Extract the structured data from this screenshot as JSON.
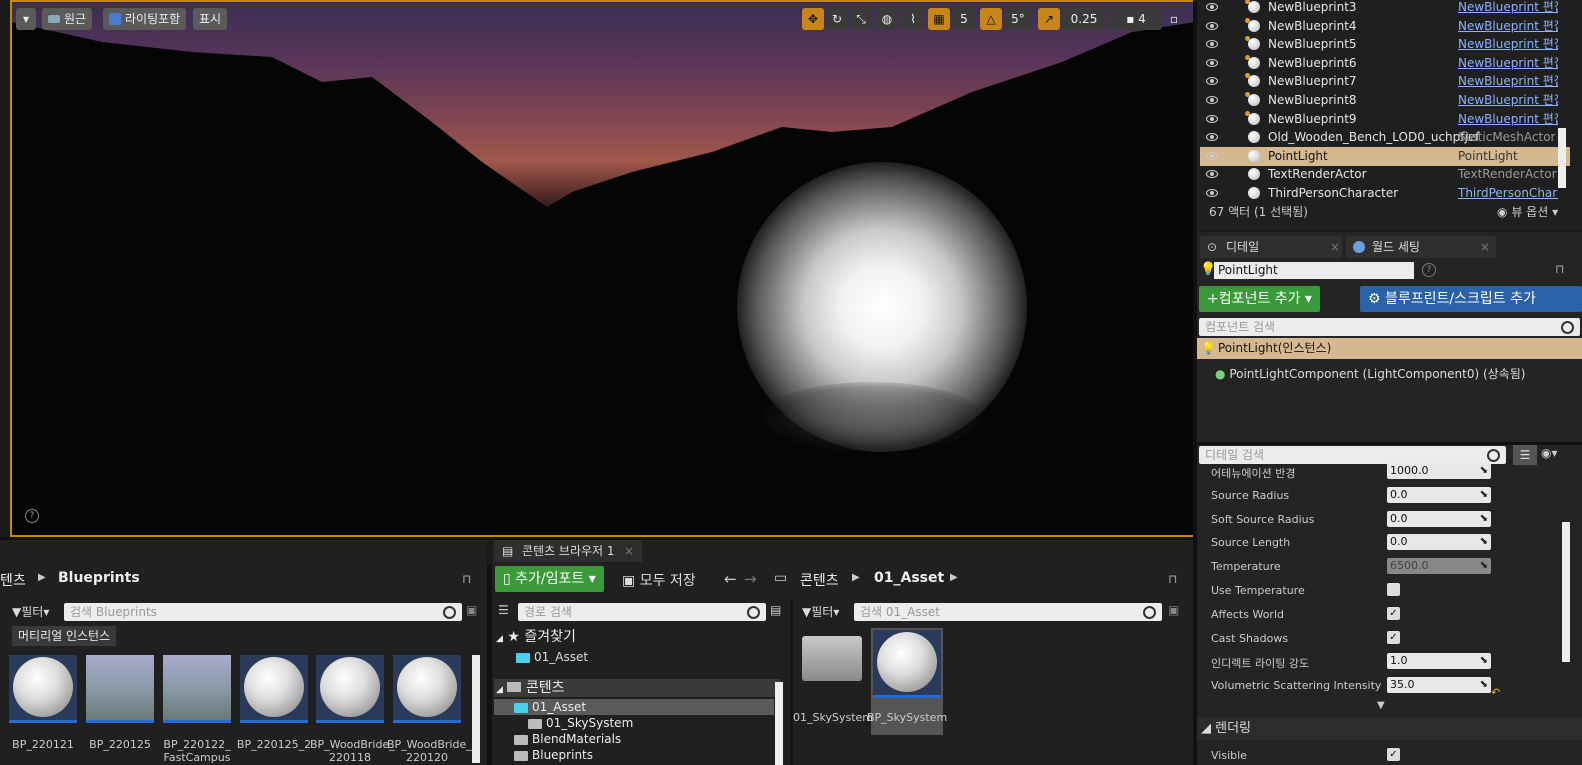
{
  "viewport": {
    "mode_btn": "원근",
    "lighting_btn": "라이팅포함",
    "show_btn": "표시",
    "grid_snap": "5",
    "rot_snap": "5°",
    "scale_snap": "0.25",
    "camera_speed": "4"
  },
  "outliner": {
    "rows": [
      {
        "name": "NewBlueprint3",
        "type": "NewBlueprint 편집"
      },
      {
        "name": "NewBlueprint4",
        "type": "NewBlueprint 편집"
      },
      {
        "name": "NewBlueprint5",
        "type": "NewBlueprint 편집"
      },
      {
        "name": "NewBlueprint6",
        "type": "NewBlueprint 편집"
      },
      {
        "name": "NewBlueprint7",
        "type": "NewBlueprint 편집"
      },
      {
        "name": "NewBlueprint8",
        "type": "NewBlueprint 편집"
      },
      {
        "name": "NewBlueprint9",
        "type": "NewBlueprint 편집"
      },
      {
        "name": "Old_Wooden_Bench_LOD0_uchpfjef",
        "type": "StaticMeshActor"
      },
      {
        "name": "PointLight",
        "type": "PointLight"
      },
      {
        "name": "TextRenderActor",
        "type": "TextRenderActor"
      },
      {
        "name": "ThirdPersonCharacter",
        "type": "ThirdPersonCharacter"
      }
    ],
    "count": "67 액터 (1 선택됨)",
    "view_options": "뷰 옵션"
  },
  "details": {
    "tab_details": "디테일",
    "tab_world": "월드 세팅",
    "actor_name": "PointLight",
    "add_component": "컴포넌트 추가",
    "add_blueprint": "블루프린트/스크립트 추가",
    "component_search": "컴포넌트 검색",
    "instance_label": "PointLight(인스턴스)",
    "component_label": "PointLightComponent (LightComponent0) (상속됨)",
    "detail_search": "디테일 검색",
    "props": [
      {
        "label": "어테뉴에이션 반경",
        "value": "1000.0"
      },
      {
        "label": "Source Radius",
        "value": "0.0"
      },
      {
        "label": "Soft Source Radius",
        "value": "0.0"
      },
      {
        "label": "Source Length",
        "value": "0.0"
      },
      {
        "label": "Temperature",
        "value": "6500.0"
      },
      {
        "label": "Use Temperature",
        "value": ""
      },
      {
        "label": "Affects World",
        "value": "✓"
      },
      {
        "label": "Cast Shadows",
        "value": "✓"
      },
      {
        "label": "인디렉트 라이팅 강도",
        "value": "1.0"
      },
      {
        "label": "Volumetric Scattering Intensity",
        "value": "35.0"
      }
    ],
    "section_rendering": "렌더링",
    "visible_label": "Visible"
  },
  "cb_left": {
    "breadcrumb_root": "텐츠",
    "breadcrumb_folder": "Blueprints",
    "filter": "필터",
    "search_placeholder": "검색 Blueprints",
    "filter_chip": "머티리얼 인스턴스",
    "assets": [
      "BP_220121",
      "BP_220125",
      "BP_220122_\nFastCampus",
      "BP_220125_2",
      "BP_WoodBride_\n220118",
      "BP_WoodBride_\n220120"
    ]
  },
  "cb_right": {
    "tab_title": "콘텐츠 브라우저 1",
    "add_import": "추가/임포트",
    "save_all": "모두 저장",
    "breadcrumb_root": "콘텐츠",
    "breadcrumb_folder": "01_Asset",
    "path_search": "경로 검색",
    "filter": "필터",
    "search_placeholder": "검색 01_Asset",
    "favorites": "즐겨찾기",
    "fav_item": "01_Asset",
    "content_root": "콘텐츠",
    "tree": [
      "01_Asset",
      "01_SkySystem",
      "BlendMaterials",
      "Blueprints"
    ],
    "assets": [
      "01_SkySystem",
      "BP_SkySystem"
    ]
  }
}
